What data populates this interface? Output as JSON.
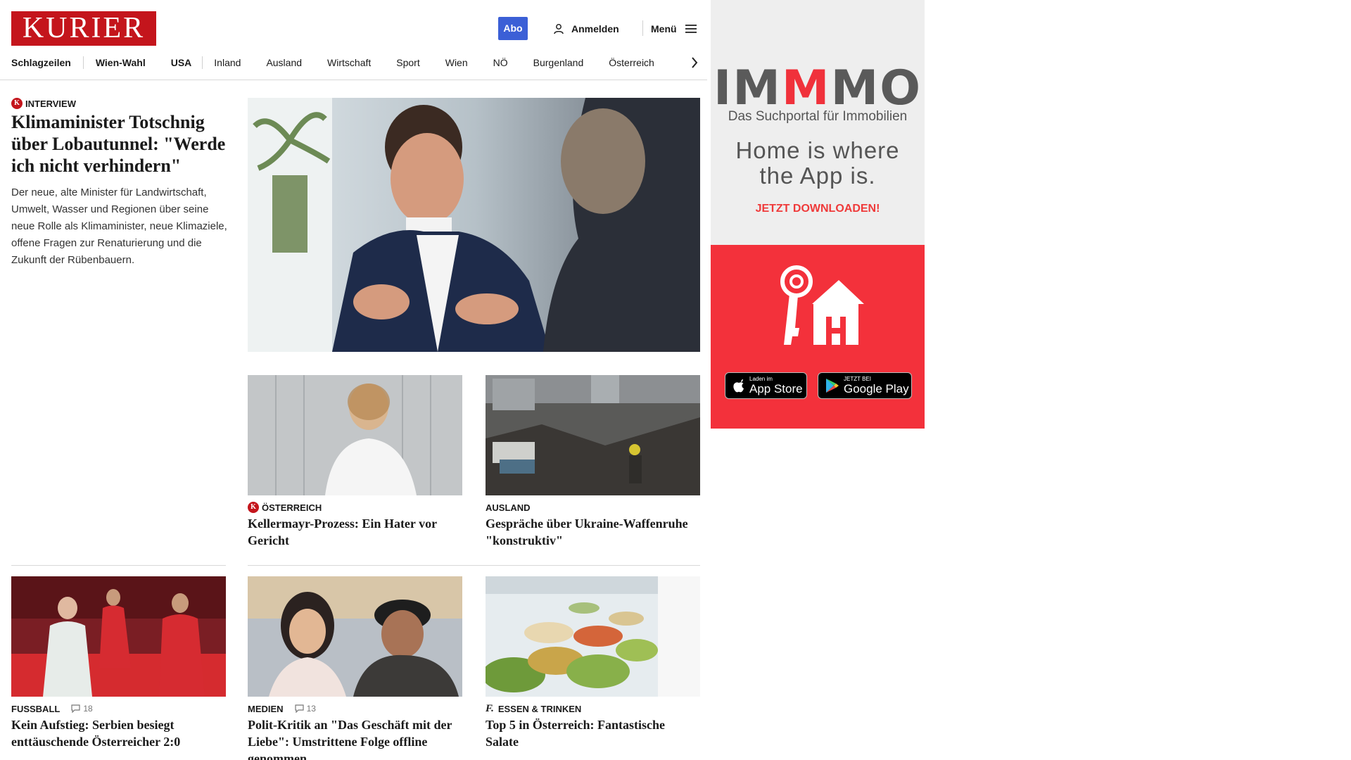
{
  "header": {
    "logo": "KURIER",
    "abo_label": "Abo",
    "login_label": "Anmelden",
    "menu_label": "Menü"
  },
  "nav": {
    "items": [
      "Schlagzeilen",
      "Wien-Wahl",
      "USA",
      "Inland",
      "Ausland",
      "Wirtschaft",
      "Sport",
      "Wien",
      "NÖ",
      "Burgenland",
      "Österreich"
    ]
  },
  "lead": {
    "kicker": "Interview",
    "title": "Klimaminister Totschnig über Lobautunnel: \"Werde ich nicht verhindern\"",
    "teaser": "Der neue, alte Minister für Landwirtschaft, Umwelt, Wasser und Regionen über seine neue Rolle als Klimaminister, neue Klimaziele, offene Fragen zur Renaturierung und die Zukunft der Rübenbauern."
  },
  "articles": [
    {
      "kicker": "Österreich",
      "title": "Kellermayr-Prozess: Ein Hater vor Gericht",
      "comments": ""
    },
    {
      "kicker": "Ausland",
      "title": "Gespräche über Ukraine-Waffenruhe \"konstruktiv\"",
      "comments": ""
    },
    {
      "kicker": "Fussball",
      "title": "Kein Aufstieg: Serbien besiegt enttäuschende Österreicher 2:0",
      "comments": "18"
    },
    {
      "kicker": "Medien",
      "title": "Polit-Kritik an \"Das Geschäft mit der Liebe\": Umstrittene Folge offline genommen",
      "comments": "13"
    },
    {
      "kicker": "Essen & Trinken",
      "title": "Top 5 in Österreich: Fantastische Salate",
      "comments": ""
    }
  ],
  "ad": {
    "brand_pre": "IM",
    "brand_mid": "M",
    "brand_post": "MO",
    "subtitle": "Das Suchportal für Immobilien",
    "slogan_line1": "Home is where",
    "slogan_line2": "the App is.",
    "cta": "JETZT DOWNLOADEN!",
    "appstore_small": "Laden im",
    "appstore_big": "App Store",
    "googleplay_small": "JETZT BEI",
    "googleplay_big": "Google Play"
  },
  "colors": {
    "brand_red": "#c4151c",
    "abo_blue": "#3b5fd6",
    "ad_red": "#f3313b"
  }
}
